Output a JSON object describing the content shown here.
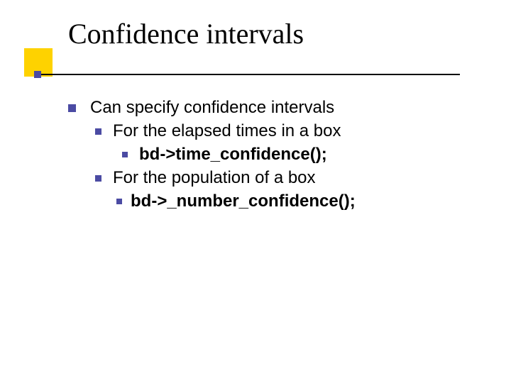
{
  "title": "Confidence intervals",
  "bullets": {
    "l0": "Can specify confidence intervals",
    "l1a": "For the elapsed times in a box",
    "l2a": "bd->time_confidence();",
    "l1b": "For the population of a box",
    "l2b": "bd->_number_confidence();"
  }
}
